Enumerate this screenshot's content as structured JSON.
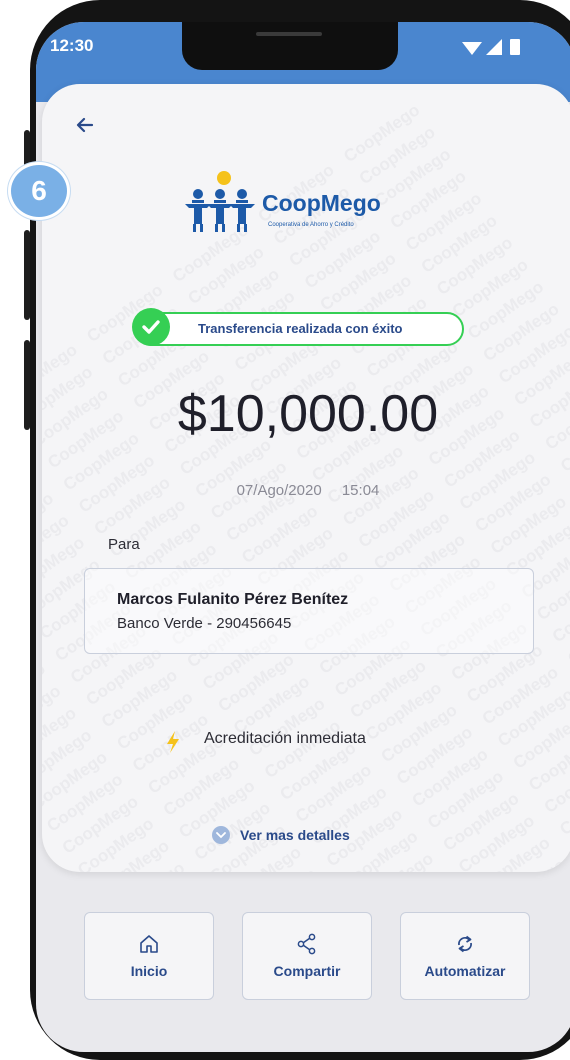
{
  "status_bar": {
    "time": "12:30"
  },
  "brand": {
    "name": "CoopMego",
    "tagline": "Cooperativa de Ahorro y Crédito",
    "watermark_word": "CoopMego"
  },
  "step": {
    "number": "6"
  },
  "transfer": {
    "success_message": "Transferencia realizada con éxito",
    "amount": "$10,000.00",
    "date": "07/Ago/2020",
    "time": "15:04",
    "to_label": "Para",
    "recipient_name": "Marcos Fulanito Pérez Benítez",
    "recipient_bank": "Banco Verde - 290456645",
    "accreditation": "Acreditación inmediata",
    "more_details": "Ver mas detalles"
  },
  "actions": [
    {
      "label": "Inicio",
      "icon": "home-icon"
    },
    {
      "label": "Compartir",
      "icon": "share-icon"
    },
    {
      "label": "Automatizar",
      "icon": "repeat-icon"
    }
  ],
  "colors": {
    "status_bar": "#4a86cf",
    "brand_blue": "#1d5aa8",
    "success_green": "#35cf54",
    "accent_yellow": "#f5c21b",
    "badge_blue": "#7ab0e6"
  }
}
